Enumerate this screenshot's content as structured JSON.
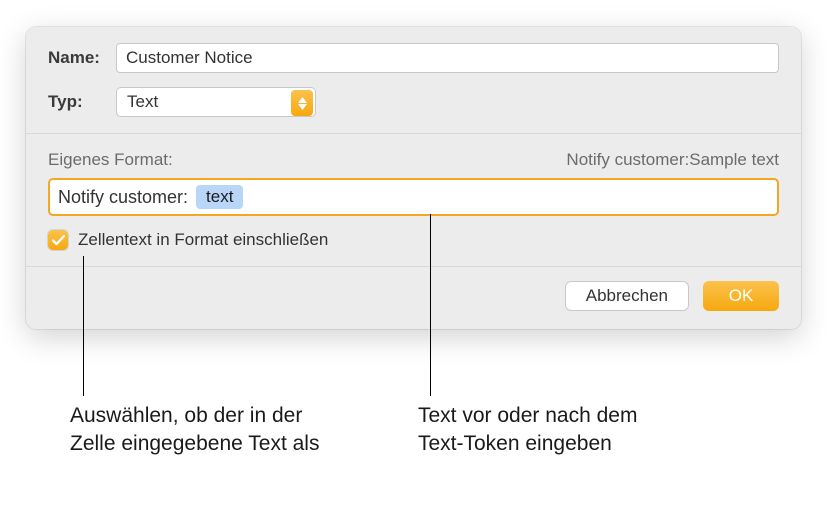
{
  "form": {
    "nameLabel": "Name:",
    "nameValue": "Customer Notice",
    "typeLabel": "Typ:",
    "typeValue": "Text"
  },
  "format": {
    "heading": "Eigenes Format:",
    "preview": "Notify customer:Sample text",
    "prefix": "Notify customer:",
    "token": "text",
    "checkboxLabel": "Zellentext in Format einschließen"
  },
  "buttons": {
    "cancel": "Abbrechen",
    "ok": "OK"
  },
  "callouts": {
    "left": "Auswählen, ob der in der Zelle eingegebene Text als",
    "right": "Text vor oder nach dem Text-Token eingeben"
  }
}
